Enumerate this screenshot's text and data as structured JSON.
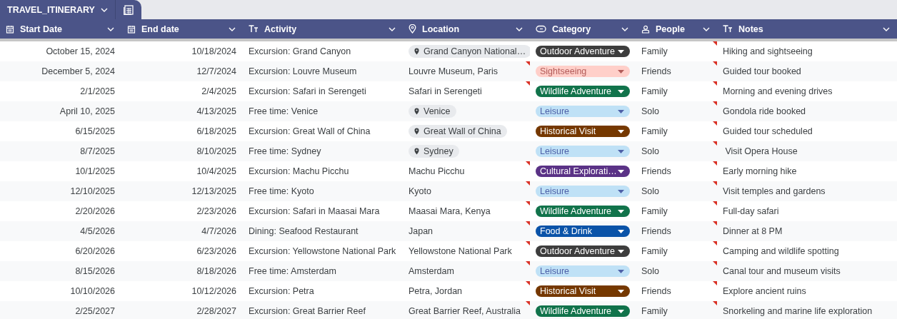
{
  "sheet_tab": {
    "label": "TRAVEL_ITINERARY"
  },
  "columns": [
    {
      "kind": "date",
      "label": "Start Date"
    },
    {
      "kind": "date",
      "label": "End date"
    },
    {
      "kind": "text",
      "label": "Activity"
    },
    {
      "kind": "place",
      "label": "Location"
    },
    {
      "kind": "chip",
      "label": "Category"
    },
    {
      "kind": "person",
      "label": "People"
    },
    {
      "kind": "text",
      "label": "Notes"
    }
  ],
  "rows": [
    {
      "start": "October 15, 2024",
      "end": "10/18/2024",
      "activity": "Excursion: Grand Canyon",
      "location": {
        "kind": "chip",
        "text": "Grand Canyon National…",
        "flagged": false
      },
      "category": {
        "text": "Outdoor Adventure",
        "color": "#3d3d3d"
      },
      "people": "Family",
      "people_flagged": true,
      "notes": "Hiking and sightseeing"
    },
    {
      "start": "December 5, 2024",
      "end": "12/7/2024",
      "activity": "Excursion: Louvre Museum",
      "location": {
        "kind": "text",
        "text": "Louvre Museum, Paris",
        "flagged": true
      },
      "category": {
        "text": "Sightseeing",
        "color": "#ffcfc9"
      },
      "people": "Friends",
      "people_flagged": true,
      "notes": "Guided tour booked"
    },
    {
      "start": "2/1/2025",
      "end": "2/4/2025",
      "activity": "Excursion: Safari in Serengeti",
      "location": {
        "kind": "text",
        "text": "Safari in Serengeti",
        "flagged": true
      },
      "category": {
        "text": "Wildlife Adventure",
        "color": "#11734b"
      },
      "people": "Family",
      "people_flagged": true,
      "notes": "Morning and evening drives"
    },
    {
      "start": "April 10, 2025",
      "end": "4/13/2025",
      "activity": "Free time: Venice",
      "location": {
        "kind": "chip",
        "text": "Venice",
        "flagged": false
      },
      "category": {
        "text": "Leisure",
        "color": "#bfe1f6"
      },
      "people": "Solo",
      "people_flagged": true,
      "notes": "Gondola ride booked"
    },
    {
      "start": "6/15/2025",
      "end": "6/18/2025",
      "activity": "Excursion: Great Wall of China",
      "location": {
        "kind": "chip",
        "text": "Great Wall of China",
        "flagged": false
      },
      "category": {
        "text": "Historical Visit",
        "color": "#753800"
      },
      "people": "Family",
      "people_flagged": true,
      "notes": "Guided tour scheduled"
    },
    {
      "start": "8/7/2025",
      "end": "8/10/2025",
      "activity": "Free time: Sydney",
      "location": {
        "kind": "chip",
        "text": "Sydney",
        "flagged": false
      },
      "category": {
        "text": "Leisure",
        "color": "#bfe1f6"
      },
      "people": "Solo",
      "people_flagged": true,
      "notes": " Visit Opera House"
    },
    {
      "start": "10/1/2025",
      "end": "10/4/2025",
      "activity": "Excursion: Machu Picchu",
      "location": {
        "kind": "text",
        "text": "Machu Picchu",
        "flagged": true
      },
      "category": {
        "text": "Cultural Explorati…",
        "color": "#5a3286"
      },
      "people": "Friends",
      "people_flagged": true,
      "notes": "Early morning hike"
    },
    {
      "start": "12/10/2025",
      "end": "12/13/2025",
      "activity": "Free time: Kyoto",
      "location": {
        "kind": "text",
        "text": "Kyoto",
        "flagged": true
      },
      "category": {
        "text": "Leisure",
        "color": "#bfe1f6"
      },
      "people": "Solo",
      "people_flagged": true,
      "notes": "Visit temples and gardens"
    },
    {
      "start": "2/20/2026",
      "end": "2/23/2026",
      "activity": "Excursion: Safari in Maasai Mara",
      "location": {
        "kind": "text",
        "text": "Maasai Mara, Kenya",
        "flagged": true
      },
      "category": {
        "text": "Wildlife Adventure",
        "color": "#11734b"
      },
      "people": "Family",
      "people_flagged": true,
      "notes": "Full-day safari"
    },
    {
      "start": "4/5/2026",
      "end": "4/7/2026",
      "activity": "Dining: Seafood Restaurant",
      "location": {
        "kind": "text",
        "text": "Japan",
        "flagged": true
      },
      "category": {
        "text": "Food & Drink",
        "color": "#0a53a8"
      },
      "people": "Friends",
      "people_flagged": true,
      "notes": "Dinner at 8 PM"
    },
    {
      "start": "6/20/2026",
      "end": "6/23/2026",
      "activity": "Excursion: Yellowstone National Park",
      "location": {
        "kind": "text",
        "text": "Yellowstone National Park",
        "flagged": true
      },
      "category": {
        "text": "Outdoor Adventure",
        "color": "#3d3d3d"
      },
      "people": "Family",
      "people_flagged": true,
      "notes": "Camping and wildlife spotting"
    },
    {
      "start": "8/15/2026",
      "end": "8/18/2026",
      "activity": "Free time: Amsterdam",
      "location": {
        "kind": "text",
        "text": "Amsterdam",
        "flagged": true
      },
      "category": {
        "text": "Leisure",
        "color": "#bfe1f6"
      },
      "people": "Solo",
      "people_flagged": true,
      "notes": "Canal tour and museum visits"
    },
    {
      "start": "10/10/2026",
      "end": "10/12/2026",
      "activity": "Excursion: Petra",
      "location": {
        "kind": "text",
        "text": "Petra, Jordan",
        "flagged": true
      },
      "category": {
        "text": "Historical Visit",
        "color": "#753800"
      },
      "people": "Friends",
      "people_flagged": true,
      "notes": "Explore ancient ruins"
    },
    {
      "start": "2/25/2027",
      "end": "2/28/2027",
      "activity": "Excursion: Great Barrier Reef",
      "location": {
        "kind": "text",
        "text": "Great Barrier Reef, Australia",
        "flagged": true
      },
      "category": {
        "text": "Wildlife Adventure",
        "color": "#11734b"
      },
      "people": "Family",
      "people_flagged": true,
      "notes": "Snorkeling and marine life exploration"
    }
  ]
}
